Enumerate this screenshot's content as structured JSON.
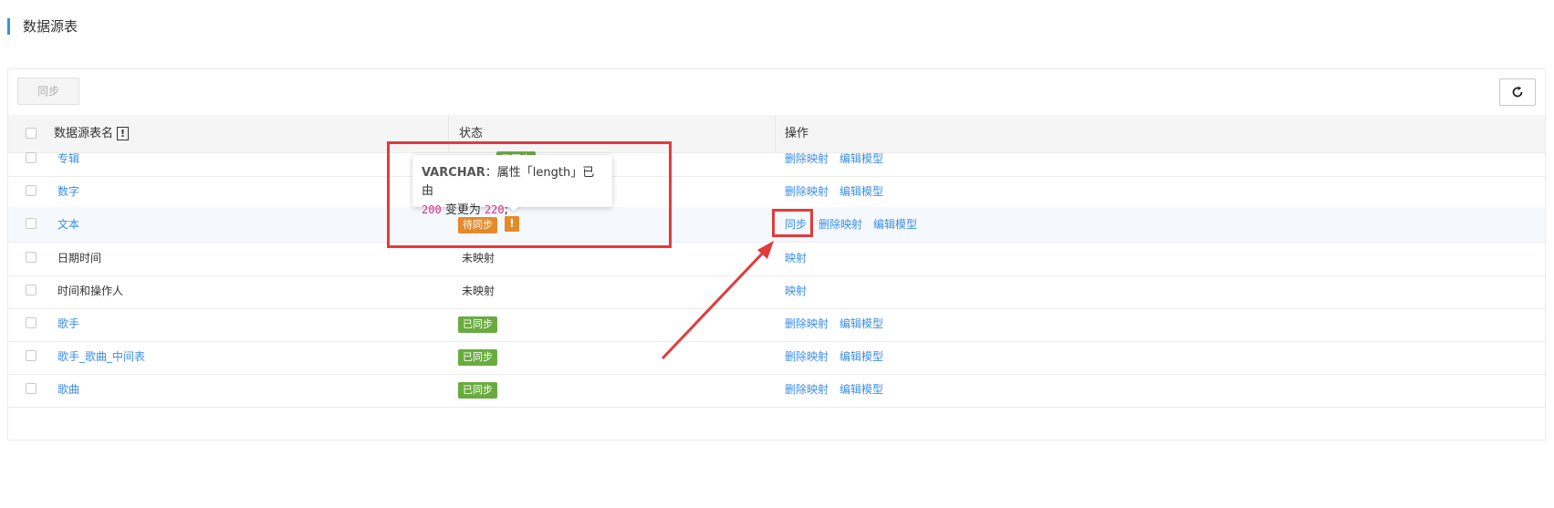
{
  "page": {
    "title": "数据源表"
  },
  "toolbar": {
    "sync_label": "同步",
    "refresh_icon": "refresh-icon"
  },
  "table": {
    "headers": {
      "name": "数据源表名",
      "status": "状态",
      "ops": "操作",
      "help_mark": "!"
    },
    "rows": [
      {
        "name": "专辑",
        "status": "已同步",
        "actions": [
          "删除映射",
          "编辑模型"
        ]
      },
      {
        "name": "数字",
        "status": "",
        "actions": [
          "删除映射",
          "编辑模型"
        ]
      },
      {
        "name": "文本",
        "status": "待同步",
        "warn": "!",
        "actions": [
          "同步",
          "删除映射",
          "编辑模型"
        ]
      },
      {
        "name": "日期时间",
        "status": "未映射",
        "actions": [
          "映射"
        ]
      },
      {
        "name": "时间和操作人",
        "status": "未映射",
        "actions": [
          "映射"
        ]
      },
      {
        "name": "歌手",
        "status": "已同步",
        "actions": [
          "删除映射",
          "编辑模型"
        ]
      },
      {
        "name": "歌手_歌曲_中间表",
        "status": "已同步",
        "actions": [
          "删除映射",
          "编辑模型"
        ]
      },
      {
        "name": "歌曲",
        "status": "已同步",
        "actions": [
          "删除映射",
          "编辑模型"
        ]
      }
    ]
  },
  "tooltip": {
    "type": "VARCHAR",
    "text_a": "：属性「length」已由",
    "from": "200",
    "text_b": " 变更为 ",
    "to": "220",
    "text_c": ";"
  },
  "colors": {
    "accent": "#3a8ee6",
    "synced": "#6aab3f",
    "pending": "#e58a2a",
    "annotation": "#e23b3b"
  }
}
